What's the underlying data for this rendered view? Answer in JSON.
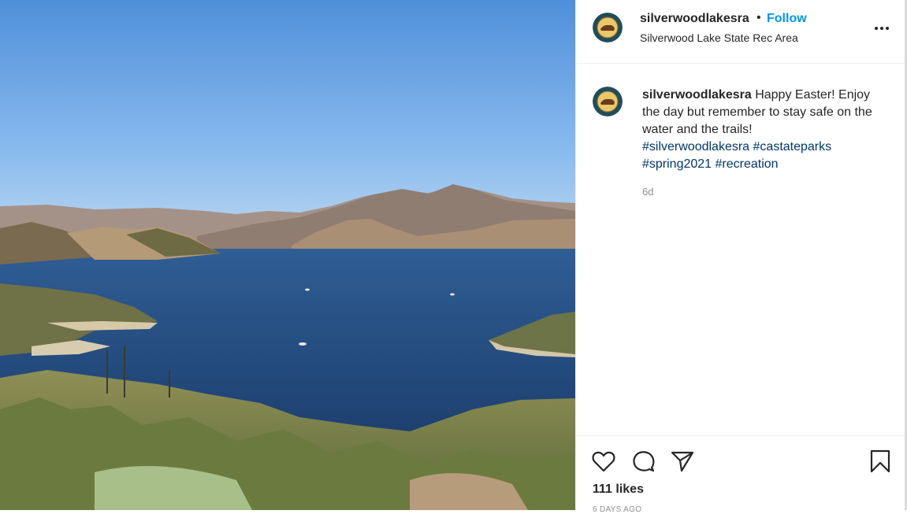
{
  "post": {
    "image_alt": "Silverwood Lake with surrounding mountains"
  },
  "header": {
    "username": "silverwoodlakesra",
    "separator": "•",
    "follow_label": "Follow",
    "location": "Silverwood Lake State Rec Area",
    "more_icon": "more-options-icon"
  },
  "caption": {
    "username": "silverwoodlakesra",
    "text": "Happy Easter! Enjoy the day but remember to stay safe on the water and the trails!",
    "hashtags": [
      "#silverwoodlakesra",
      "#castateparks",
      "#spring2021",
      "#recreation"
    ],
    "age": "6d"
  },
  "actions": {
    "like_icon": "heart-icon",
    "comment_icon": "comment-icon",
    "share_icon": "share-icon",
    "save_icon": "bookmark-icon"
  },
  "stats": {
    "likes": "111 likes",
    "date": "6 DAYS AGO"
  },
  "colors": {
    "accent": "#0095f6",
    "hashtag": "#00376b",
    "muted": "#8e8e8e",
    "text": "#262626"
  }
}
